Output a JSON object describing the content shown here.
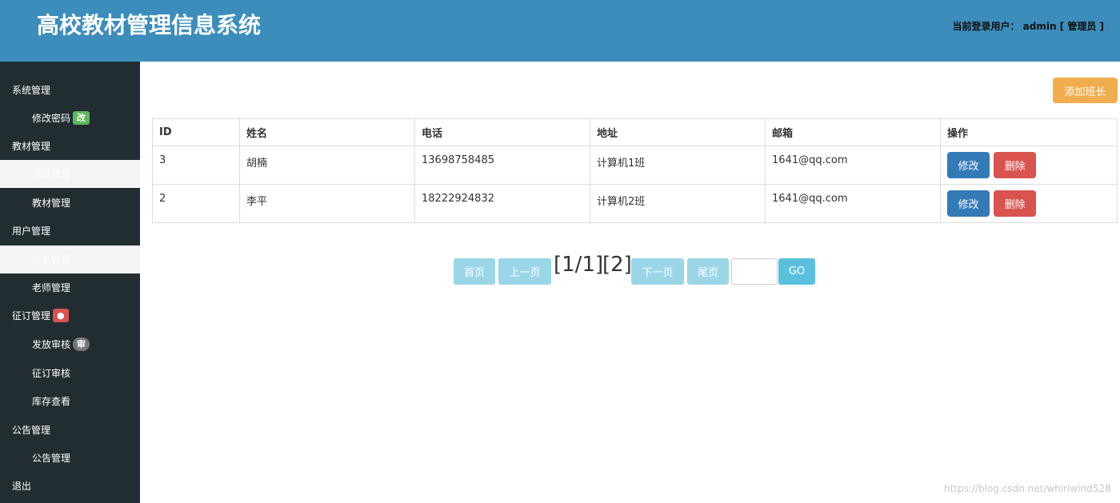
{
  "header": {
    "title": "高校教材管理信息系统",
    "user_info": "当前登录用户： admin [ 管理员 ]"
  },
  "sidebar": {
    "items": [
      {
        "label": "系统管理",
        "badge": ""
      },
      {
        "label": "修改密码",
        "badge": "改"
      },
      {
        "label": "教材管理",
        "badge": ""
      },
      {
        "label": "课程管理",
        "badge": ""
      },
      {
        "label": "教材管理",
        "badge": ""
      },
      {
        "label": "用户管理",
        "badge": ""
      },
      {
        "label": "班长管理",
        "badge": ""
      },
      {
        "label": "老师管理",
        "badge": ""
      },
      {
        "label": "征订管理",
        "badge": "●"
      },
      {
        "label": "发放审核",
        "badge": "审"
      },
      {
        "label": "征订审核",
        "badge": ""
      },
      {
        "label": "库存查看",
        "badge": ""
      },
      {
        "label": "公告管理",
        "badge": ""
      },
      {
        "label": "公告管理",
        "badge": ""
      },
      {
        "label": "退出",
        "badge": ""
      }
    ]
  },
  "toolbar": {
    "add_label": "添加班长"
  },
  "table": {
    "headers": [
      "ID",
      "姓名",
      "电话",
      "地址",
      "邮箱",
      "操作"
    ],
    "rows": [
      {
        "id": "3",
        "name": "胡楠",
        "phone": "13698758485",
        "address": "计算机1班",
        "email": "1641@qq.com"
      },
      {
        "id": "2",
        "name": "李平",
        "phone": "18222924832",
        "address": "计算机2班",
        "email": "1641@qq.com"
      }
    ],
    "edit_label": "修改",
    "delete_label": "删除"
  },
  "pagination": {
    "first": "首页",
    "prev": "上一页",
    "page_status": "[1/1]",
    "page_link": "[2]",
    "next": "下一页",
    "last": "尾页",
    "go": "GO"
  },
  "watermark": "https://blog.csdn.net/whirlwind528"
}
